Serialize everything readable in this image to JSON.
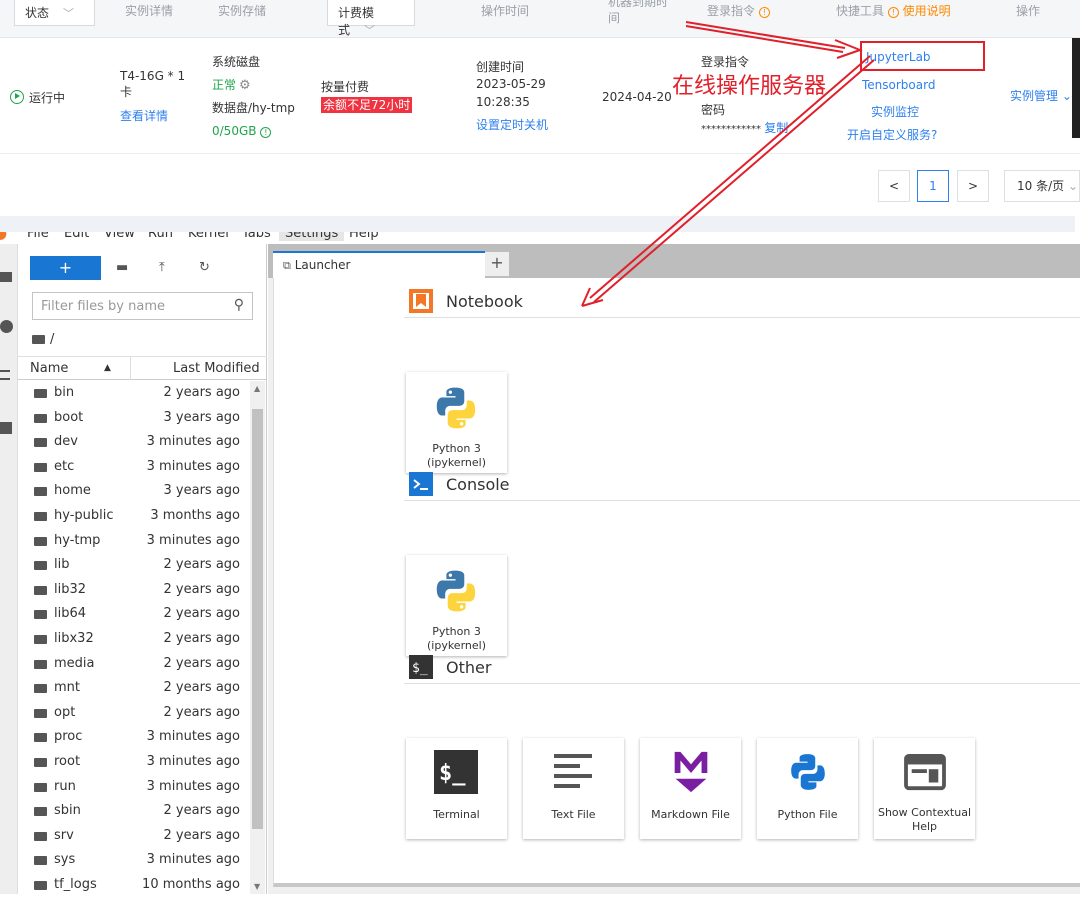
{
  "console": {
    "headers": {
      "status": "状态",
      "details": "实例详情",
      "storage": "实例存储",
      "billing": "计费模式",
      "op_time": "操作时间",
      "expire": "机器到期时间",
      "login": "登录指令",
      "tools": "快捷工具",
      "tools_help": "使用说明",
      "actions": "操作"
    },
    "instance": {
      "status": "运行中",
      "gpu": "T4-16G * 1",
      "gpu_unit": "卡",
      "view_details": "查看详情",
      "sys_disk": "系统磁盘",
      "sys_disk_status": "正常",
      "data_disk": "数据盘/hy-tmp",
      "data_disk_usage": "0/50GB",
      "billing_mode": "按量付费",
      "balance_warning": "余额不足72小时",
      "created_label": "创建时间",
      "created_date": "2023-05-29",
      "created_time": "10:28:35",
      "set_shutdown": "设置定时关机",
      "expire_date": "2024-04-20",
      "login_label": "登录指令",
      "password_label": "密码",
      "password_mask": "************",
      "copy": "复制",
      "jupyterlab": "JupyterLab",
      "tensorboard": "Tensorboard",
      "monitor": "实例监控",
      "custom_service": "开启自定义服务?",
      "manage": "实例管理"
    },
    "annotation": "在线操作服务器",
    "pagination": {
      "current_page": "1",
      "page_size": "10 条/页"
    }
  },
  "jupyter": {
    "menu": [
      "File",
      "Edit",
      "View",
      "Run",
      "Kernel",
      "Tabs",
      "Settings",
      "Help"
    ],
    "new_button": "+",
    "filter_placeholder": "Filter files by name",
    "breadcrumb": "/",
    "col_name": "Name",
    "col_modified": "Last Modified",
    "files": [
      {
        "name": "bin",
        "modified": "2 years ago"
      },
      {
        "name": "boot",
        "modified": "3 years ago"
      },
      {
        "name": "dev",
        "modified": "3 minutes ago"
      },
      {
        "name": "etc",
        "modified": "3 minutes ago"
      },
      {
        "name": "home",
        "modified": "3 years ago"
      },
      {
        "name": "hy-public",
        "modified": "3 months ago"
      },
      {
        "name": "hy-tmp",
        "modified": "3 minutes ago"
      },
      {
        "name": "lib",
        "modified": "2 years ago"
      },
      {
        "name": "lib32",
        "modified": "2 years ago"
      },
      {
        "name": "lib64",
        "modified": "2 years ago"
      },
      {
        "name": "libx32",
        "modified": "2 years ago"
      },
      {
        "name": "media",
        "modified": "2 years ago"
      },
      {
        "name": "mnt",
        "modified": "2 years ago"
      },
      {
        "name": "opt",
        "modified": "2 years ago"
      },
      {
        "name": "proc",
        "modified": "3 minutes ago"
      },
      {
        "name": "root",
        "modified": "3 minutes ago"
      },
      {
        "name": "run",
        "modified": "3 minutes ago"
      },
      {
        "name": "sbin",
        "modified": "2 years ago"
      },
      {
        "name": "srv",
        "modified": "2 years ago"
      },
      {
        "name": "sys",
        "modified": "3 minutes ago"
      },
      {
        "name": "tf_logs",
        "modified": "10 months ago"
      }
    ],
    "tab_label": "Launcher",
    "sections": {
      "notebook": "Notebook",
      "console": "Console",
      "other": "Other"
    },
    "cards": {
      "nb_python_1": "Python 3",
      "nb_python_2": "(ipykernel)",
      "con_python_1": "Python 3",
      "con_python_2": "(ipykernel)",
      "terminal": "Terminal",
      "text_file": "Text File",
      "markdown_file": "Markdown File",
      "python_file": "Python File",
      "help_1": "Show Contextual",
      "help_2": "Help"
    }
  },
  "colors": {
    "accent": "#1976d2",
    "link": "#2f80ed",
    "annotation_red": "#e0202a",
    "running_green": "#1fa54c"
  }
}
